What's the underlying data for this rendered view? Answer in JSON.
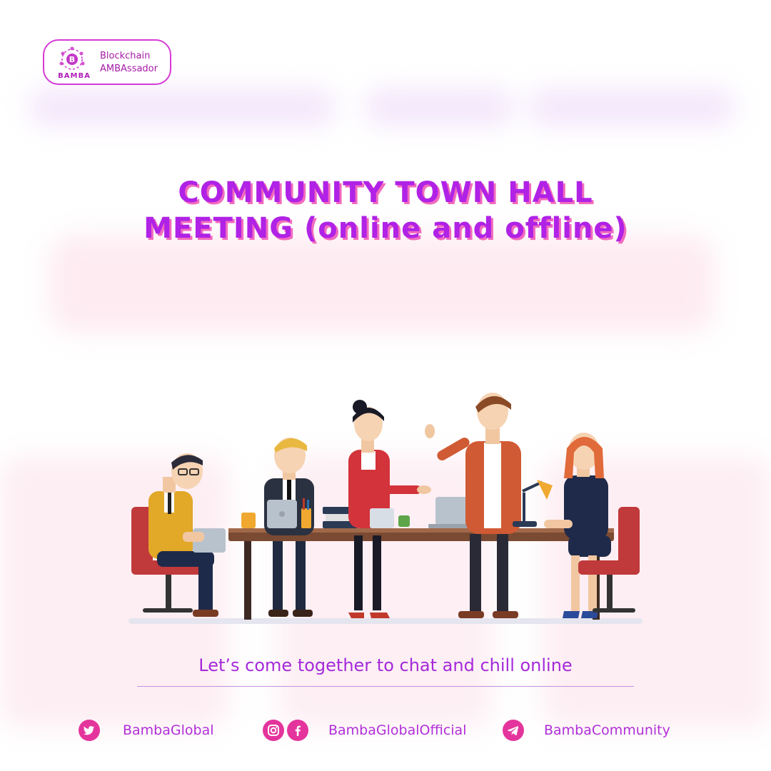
{
  "brand": {
    "name": "BAMBA",
    "mark_letter": "B",
    "tagline_line1": "Blockchain",
    "tagline_line2": "AMBAssador"
  },
  "headline": {
    "line1": "COMMUNITY TOWN HALL",
    "line2": "MEETING (online and offline)"
  },
  "tagline": "Let’s come together to chat and chill online",
  "socials": {
    "twitter": {
      "icon": "twitter-icon",
      "handle": "BambaGlobal"
    },
    "instagram_facebook": {
      "icons": [
        "instagram-icon",
        "facebook-icon"
      ],
      "handle": "BambaGlobalOfficial"
    },
    "telegram": {
      "icon": "telegram-icon",
      "handle": "BambaCommunity"
    }
  },
  "colors": {
    "primary_purple": "#b022e6",
    "accent_pink": "#e4359c",
    "headline_shadow": "#f26bbd"
  }
}
